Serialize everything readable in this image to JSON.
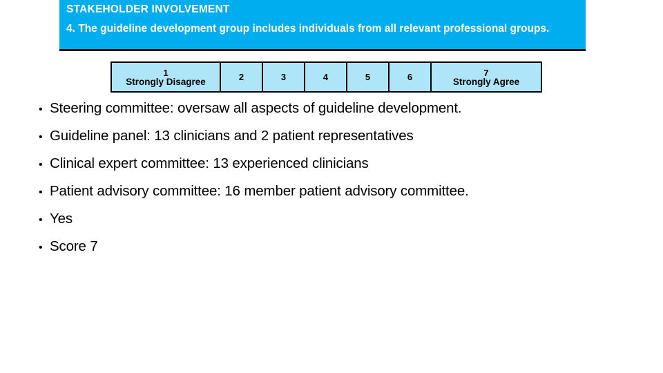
{
  "header": {
    "domain_title": "STAKEHOLDER INVOLVEMENT",
    "question_text": "4. The guideline development group includes individuals from all relevant professional groups.",
    "background_color": "#00AEEF",
    "text_color": "#FFFFFF"
  },
  "likert_scale": {
    "cell_background_color": "#AEE5F8",
    "border_color": "#000000",
    "cells": [
      {
        "number": "1",
        "label": "Strongly Disagree",
        "type": "anchor"
      },
      {
        "number": "2",
        "label": "",
        "type": "plain"
      },
      {
        "number": "3",
        "label": "",
        "type": "plain"
      },
      {
        "number": "4",
        "label": "",
        "type": "plain"
      },
      {
        "number": "5",
        "label": "",
        "type": "plain"
      },
      {
        "number": "6",
        "label": "",
        "type": "plain"
      },
      {
        "number": "7",
        "label": "Strongly Agree",
        "type": "anchor"
      }
    ]
  },
  "bullets": {
    "marker": "•",
    "items": [
      {
        "text": "Steering committee: oversaw all aspects of guideline development."
      },
      {
        "text": "Guideline panel: 13 clinicians and 2 patient representatives"
      },
      {
        "text": "Clinical expert committee: 13 experienced clinicians"
      },
      {
        "text": "Patient advisory committee: 16 member patient advisory committee."
      },
      {
        "text": "Yes"
      },
      {
        "text": "Score 7"
      }
    ]
  }
}
